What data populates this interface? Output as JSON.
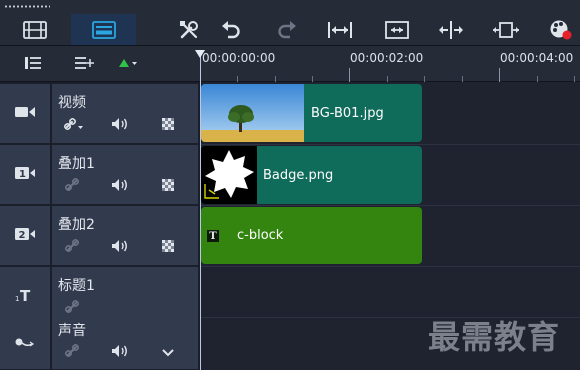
{
  "toolbar": {
    "buttons": [
      {
        "name": "storyboard-view",
        "icon": "filmstrip-icon"
      },
      {
        "name": "timeline-view",
        "icon": "timeline-icon",
        "active": true
      },
      {
        "name": "tools",
        "icon": "tools-icon"
      },
      {
        "name": "undo",
        "icon": "undo-icon"
      },
      {
        "name": "redo",
        "icon": "redo-icon"
      },
      {
        "name": "fit-project",
        "icon": "fit-width-icon"
      },
      {
        "name": "screen-capture",
        "icon": "screen-capture-icon"
      },
      {
        "name": "split",
        "icon": "split-icon"
      },
      {
        "name": "resize",
        "icon": "resize-icon"
      },
      {
        "name": "sound-mixer",
        "icon": "sound-mixer-icon"
      }
    ]
  },
  "ruler": {
    "labels": [
      "00:00:00:00",
      "00:00:02:00",
      "00:00:04:00"
    ]
  },
  "tracks": [
    {
      "name": "视频",
      "icon": "video-track-icon"
    },
    {
      "name": "叠加1",
      "icon": "overlay-track-1-icon"
    },
    {
      "name": "叠加2",
      "icon": "overlay-track-2-icon"
    },
    {
      "name": "标题1",
      "icon": "title-track-icon"
    },
    {
      "name": "声音",
      "icon": "voice-track-icon"
    }
  ],
  "clips": {
    "video": {
      "label": "BG-B01.jpg",
      "color": "#0f6b5a"
    },
    "overlay1": {
      "label": "Badge.png",
      "color": "#0f6b5a"
    },
    "overlay2": {
      "label": "c-block",
      "color": "#33850f"
    }
  },
  "colors": {
    "accent": "#2aa6e0",
    "play_indicator": "#2ec44a",
    "mixer_dot": "#e8202a"
  },
  "watermark": "最需教育"
}
